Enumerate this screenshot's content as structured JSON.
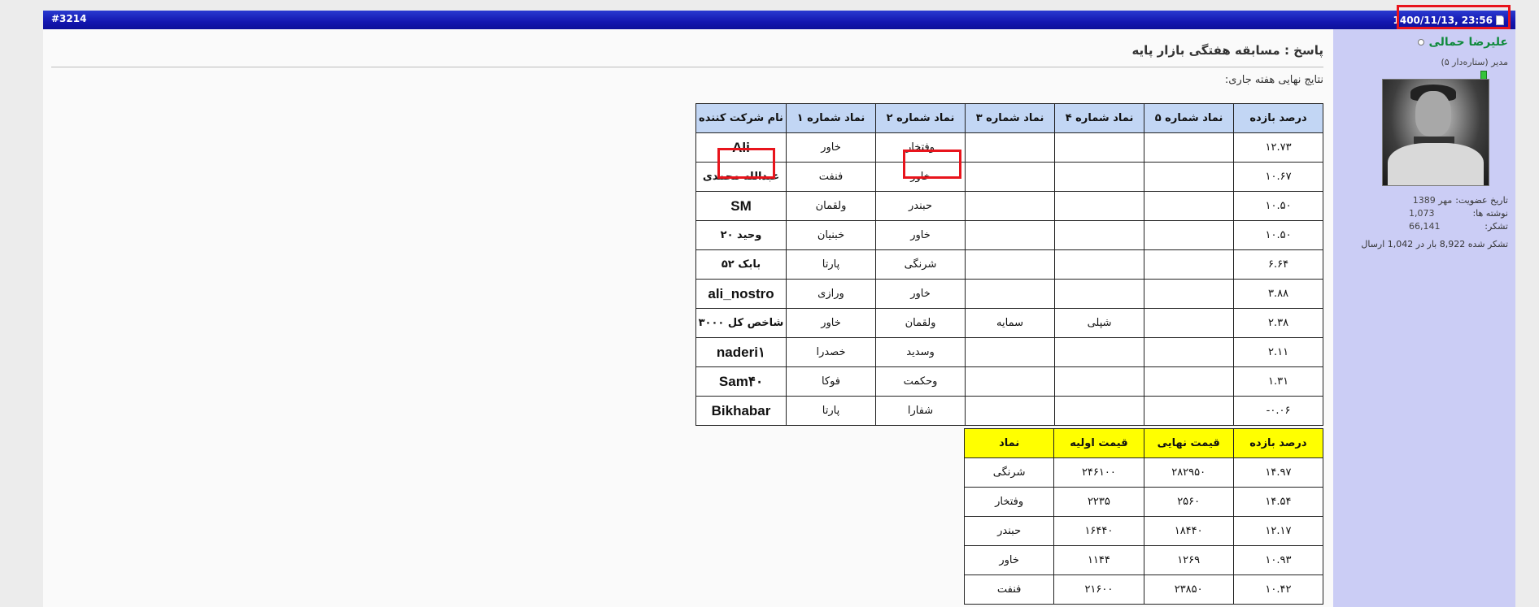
{
  "post": {
    "number": "#3214",
    "date": "1400/11/13, 23:56",
    "user": {
      "name": "علیرضا حمالی",
      "title": "مدیر (ستاره‌دار ۵)",
      "stats": [
        {
          "label": "تاریخ عضویت:",
          "value": "مهر 1389"
        },
        {
          "label": "نوشته ها:",
          "value": "1,073"
        },
        {
          "label": "تشکر:",
          "value": "66,141"
        }
      ],
      "thanks_line": "تشکر شده 8,922 بار در 1,042 ارسال"
    },
    "title": "پاسخ : مسابقه هفتگی بازار پایه",
    "subtitle": "نتایج نهایی هفته جاری:"
  },
  "table1": {
    "headers": [
      "درصد بازده",
      "نماد شماره ۵",
      "نماد شماره ۴",
      "نماد شماره ۳",
      "نماد شماره ۲",
      "نماد شماره ۱",
      "نام شرکت کننده"
    ],
    "rows": [
      [
        "۱۲.۷۳",
        "",
        "",
        "",
        "وفتخار",
        "خاور",
        "Ali"
      ],
      [
        "۱۰.۶۷",
        "",
        "",
        "",
        "خاور",
        "فنفت",
        "عبدالله محمدی"
      ],
      [
        "۱۰.۵۰",
        "",
        "",
        "",
        "حبندر",
        "ولقمان",
        "SM"
      ],
      [
        "۱۰.۵۰",
        "",
        "",
        "",
        "خاور",
        "خبنیان",
        "وحید ۲۰"
      ],
      [
        "۶.۶۴",
        "",
        "",
        "",
        "شرنگی",
        "پارتا",
        "بابک ۵۲"
      ],
      [
        "۳.۸۸",
        "",
        "",
        "",
        "خاور",
        "ورازی",
        "ali_nostro"
      ],
      [
        "۲.۳۸",
        "",
        "شپلی",
        "سمایه",
        "ولقمان",
        "خاور",
        "شاخص کل ۳۰۰۰"
      ],
      [
        "۲.۱۱",
        "",
        "",
        "",
        "وسدید",
        "خصدرا",
        "naderi۱"
      ],
      [
        "۱.۳۱",
        "",
        "",
        "",
        "وحکمت",
        "فوکا",
        "Sam۴۰"
      ],
      [
        "۰.۰۶-",
        "",
        "",
        "",
        "شفارا",
        "پارتا",
        "Bikhabar"
      ]
    ]
  },
  "table2": {
    "headers": [
      "درصد بازده",
      "قیمت نهایی",
      "قیمت اولیه",
      "نماد"
    ],
    "rows": [
      [
        "۱۴.۹۷",
        "۲۸۲۹۵۰",
        "۲۴۶۱۰۰",
        "شرنگی"
      ],
      [
        "۱۴.۵۴",
        "۲۵۶۰",
        "۲۲۳۵",
        "وفتخار"
      ],
      [
        "۱۲.۱۷",
        "۱۸۴۴۰",
        "۱۶۴۴۰",
        "حبندر"
      ],
      [
        "۱۰.۹۳",
        "۱۲۶۹",
        "۱۱۴۴",
        "خاور"
      ],
      [
        "۱۰.۴۲",
        "۲۳۸۵۰",
        "۲۱۶۰۰",
        "فنفت"
      ]
    ]
  },
  "colors": {
    "header_blue": "#1417b0",
    "user_panel": "#cbcdf5",
    "table1_header": "#c2d6f4",
    "table2_header": "#ffff00",
    "highlight_red": "#e8141c",
    "username_green": "#0f8a3c"
  },
  "icons": {
    "date": "document-icon",
    "status": "offline-status-icon"
  }
}
